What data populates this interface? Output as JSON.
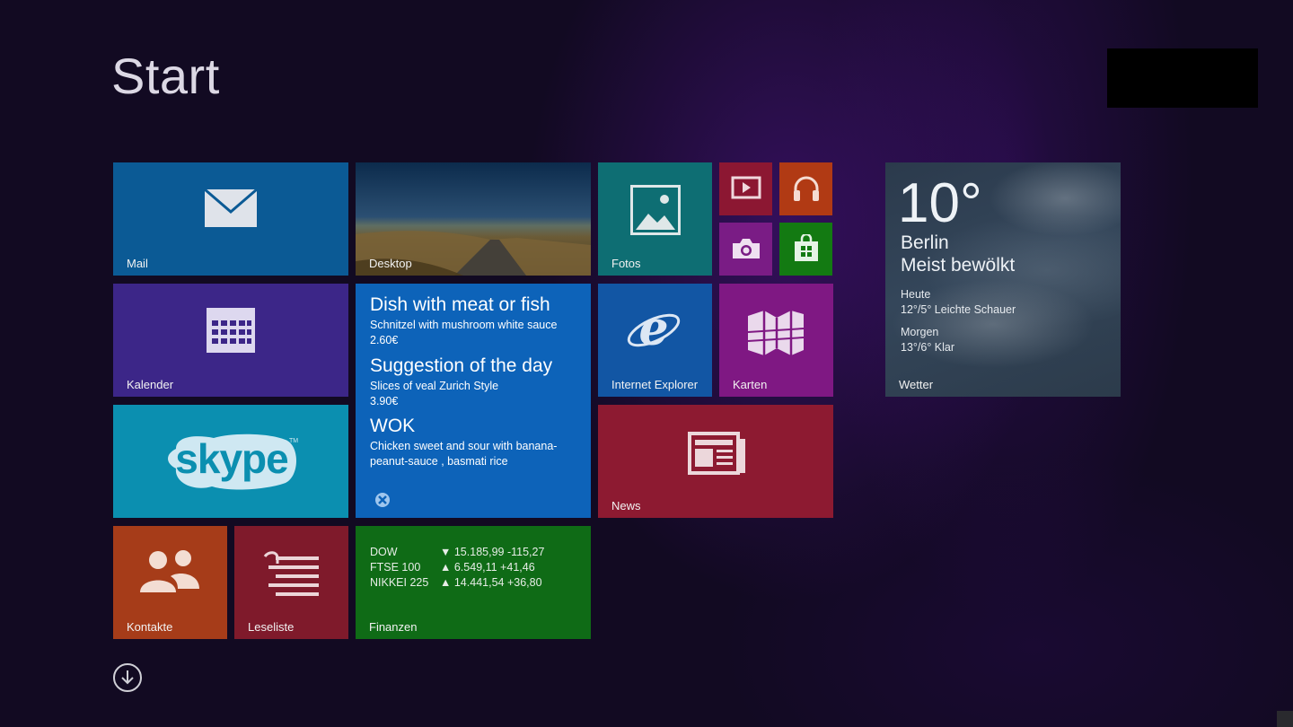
{
  "screen": {
    "title": "Start"
  },
  "tiles": {
    "mail": {
      "label": "Mail",
      "icon": "mail-icon"
    },
    "desktop": {
      "label": "Desktop"
    },
    "fotos": {
      "label": "Fotos",
      "icon": "photos-icon"
    },
    "video": {
      "icon": "video-icon"
    },
    "music": {
      "icon": "headphones-icon"
    },
    "camera": {
      "icon": "camera-icon"
    },
    "store": {
      "icon": "store-icon"
    },
    "kalender": {
      "label": "Kalender",
      "icon": "calendar-icon"
    },
    "food": {
      "items": [
        {
          "heading": "Dish with meat or fish",
          "line1": "Schnitzel with mushroom white sauce",
          "line2": "2.60€"
        },
        {
          "heading": "Suggestion of the day",
          "line1": "Slices of veal Zurich Style",
          "line2": "3.90€"
        },
        {
          "heading": "WOK",
          "line1": "Chicken sweet and sour with banana-",
          "line2": "peanut-sauce , basmati rice"
        }
      ],
      "icon": "app-badge-icon"
    },
    "ie": {
      "label": "Internet Explorer",
      "icon": "internet-explorer-icon"
    },
    "karten": {
      "label": "Karten",
      "icon": "map-icon"
    },
    "skype": {
      "logo_text": "skype",
      "tm": "TM"
    },
    "news": {
      "label": "News",
      "icon": "newspaper-icon"
    },
    "kontakte": {
      "label": "Kontakte",
      "icon": "people-icon"
    },
    "leseliste": {
      "label": "Leseliste",
      "icon": "reading-list-icon"
    },
    "finanzen": {
      "label": "Finanzen",
      "rows": [
        {
          "name": "DOW",
          "arrow": "▼",
          "value": "15.185,99 -115,27"
        },
        {
          "name": "FTSE 100",
          "arrow": "▲",
          "value": "6.549,11 +41,46"
        },
        {
          "name": "NIKKEI 225",
          "arrow": "▲",
          "value": "14.441,54 +36,80"
        }
      ]
    },
    "wetter": {
      "temp": "10°",
      "city": "Berlin",
      "condition": "Meist bewölkt",
      "today_label": "Heute",
      "today_forecast": "12°/5° Leichte Schauer",
      "tomorrow_label": "Morgen",
      "tomorrow_forecast": "13°/6° Klar",
      "label": "Wetter"
    }
  },
  "footer": {
    "all_apps_icon": "arrow-down-circle-icon"
  }
}
